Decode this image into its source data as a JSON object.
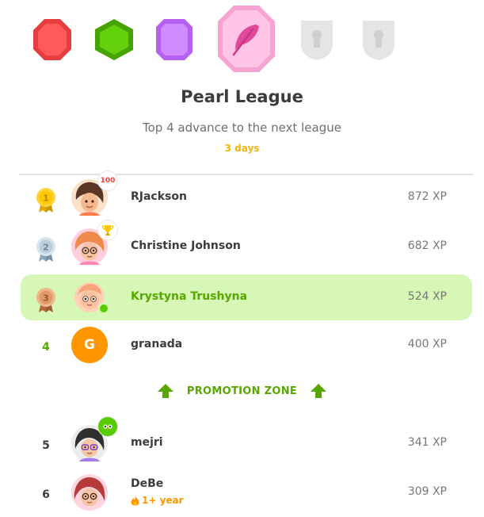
{
  "league_badges": [
    {
      "name": "ruby",
      "color": "#ff4b4b",
      "locked": false
    },
    {
      "name": "emerald",
      "color": "#58cc02",
      "locked": false
    },
    {
      "name": "amethyst",
      "color": "#ce82ff",
      "locked": false
    },
    {
      "name": "pearl",
      "color": "#ffb2e1",
      "locked": false,
      "current": true,
      "icon": "feather-icon"
    },
    {
      "name": "locked-1",
      "color": "#e5e5e5",
      "locked": true,
      "icon": "keyhole-icon"
    },
    {
      "name": "locked-2",
      "color": "#e5e5e5",
      "locked": true,
      "icon": "keyhole-icon"
    }
  ],
  "header": {
    "title": "Pearl League",
    "subtitle": "Top 4 advance to the next league",
    "time_left": "3 days"
  },
  "leaderboard": [
    {
      "rank": "1",
      "medal": "gold",
      "name": "RJackson",
      "xp": "872 XP",
      "sticker": "100",
      "avatar_color": "#f5c9a6"
    },
    {
      "rank": "2",
      "medal": "silver",
      "name": "Christine Johnson",
      "xp": "682 XP",
      "sticker": "trophy-icon",
      "avatar_color": "#ffb7c9"
    },
    {
      "rank": "3",
      "medal": "bronze",
      "name": "Krystyna Trushyna",
      "xp": "524 XP",
      "current_user": true,
      "avatar_color": "#ffc7a8"
    },
    {
      "rank": "4",
      "name": "granada",
      "xp": "400 XP",
      "initial": "G",
      "avatar_color": "#ff9600"
    }
  ],
  "promotion_zone_label": "PROMOTION ZONE",
  "leaderboard_below": [
    {
      "rank": "5",
      "name": "mejri",
      "xp": "341 XP",
      "sticker": "owl-icon",
      "avatar_color": "#e8e8e8"
    },
    {
      "rank": "6",
      "name": "DeBe",
      "xp": "309 XP",
      "streak_label": "1+ year",
      "avatar_color": "#ffcfd8"
    }
  ]
}
